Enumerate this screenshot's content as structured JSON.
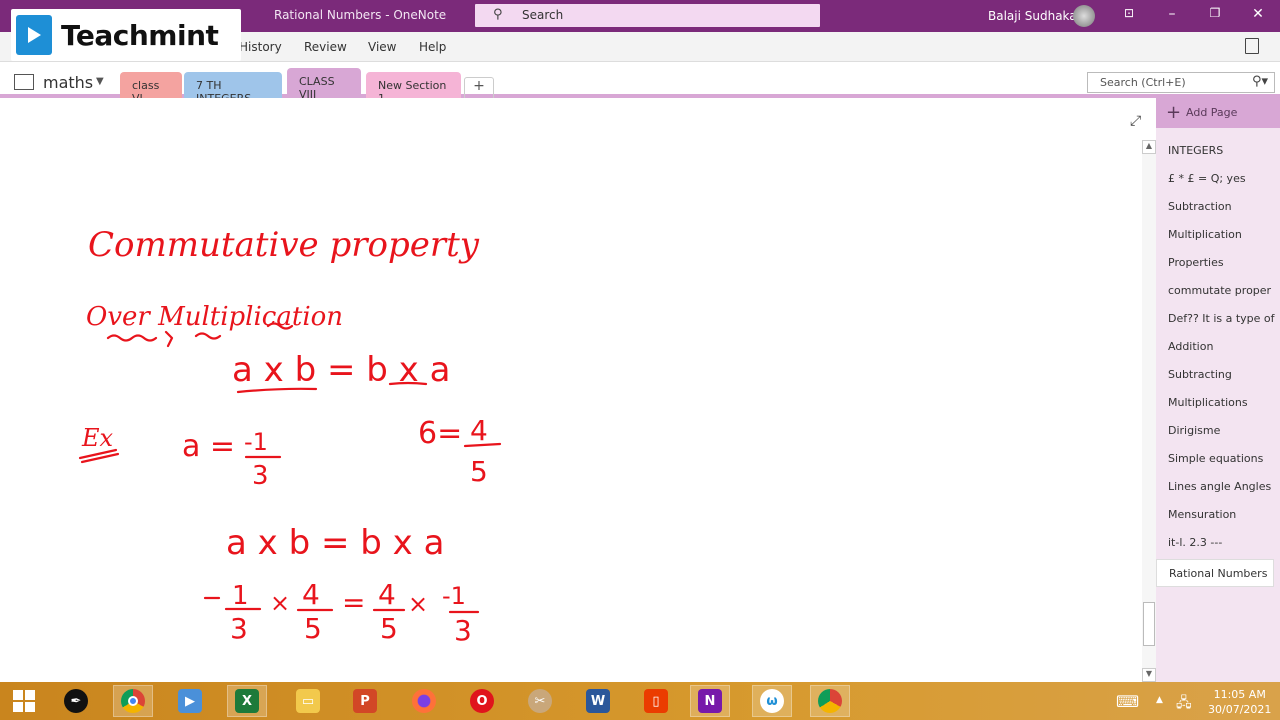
{
  "window": {
    "title": "Rational Numbers  -  OneNote",
    "search_placeholder": "Search",
    "user_name": "Balaji Sudhakar",
    "controls": [
      "restore-ribbon",
      "minimize",
      "maximize",
      "close"
    ]
  },
  "overlay_logo": {
    "text": "Teachmint"
  },
  "menu": {
    "items": [
      {
        "label": "History"
      },
      {
        "label": "Review"
      },
      {
        "label": "View"
      },
      {
        "label": "Help"
      }
    ]
  },
  "notebook": {
    "name": "maths",
    "sections": [
      {
        "label": "class VI",
        "color": "#f4a3a0"
      },
      {
        "label": "7 TH INTEGERS",
        "color": "#9fc5ea"
      },
      {
        "label": "CLASS VIII",
        "color": "#d8a7d5",
        "active": true
      },
      {
        "label": "New Section 1",
        "color": "#f5b4d6"
      }
    ],
    "add_section_label": "+",
    "page_search_placeholder": "Search (Ctrl+E)"
  },
  "pages": {
    "add_page_label": "Add Page",
    "items": [
      {
        "label": "INTEGERS"
      },
      {
        "label": "£ * £ = Q; yes"
      },
      {
        "label": "Subtraction"
      },
      {
        "label": "Multiplication"
      },
      {
        "label": "Properties"
      },
      {
        "label": "commutate proper"
      },
      {
        "label": "Def?? It is a type of"
      },
      {
        "label": "Addition"
      },
      {
        "label": "Subtracting"
      },
      {
        "label": "Multiplications"
      },
      {
        "label": "Dirigisme"
      },
      {
        "label": "Simple equations"
      },
      {
        "label": "Lines angle Angles"
      },
      {
        "label": "Mensuration"
      },
      {
        "label": "it-l. 2.3 ---"
      },
      {
        "label": "Rational Numbers",
        "selected": true
      }
    ]
  },
  "note": {
    "ink_color": "#e8141c",
    "handwriting": [
      "Commutative property",
      "Over Multiplication",
      "a x b = b x a",
      "Ex",
      "a = -1/3",
      "b = 4/5",
      "a x b = b x a",
      "-1/3 x 4/5 = 4/5 x -1/3"
    ]
  },
  "taskbar": {
    "apps": [
      "windows-start",
      "pen-app",
      "chrome",
      "media-player",
      "excel",
      "file-explorer",
      "powerpoint",
      "firefox",
      "opera",
      "snipping-tool",
      "word",
      "office",
      "onenote",
      "whiteboard",
      "chrome-profile"
    ],
    "time": "11:05 AM",
    "date": "30/07/2021"
  }
}
